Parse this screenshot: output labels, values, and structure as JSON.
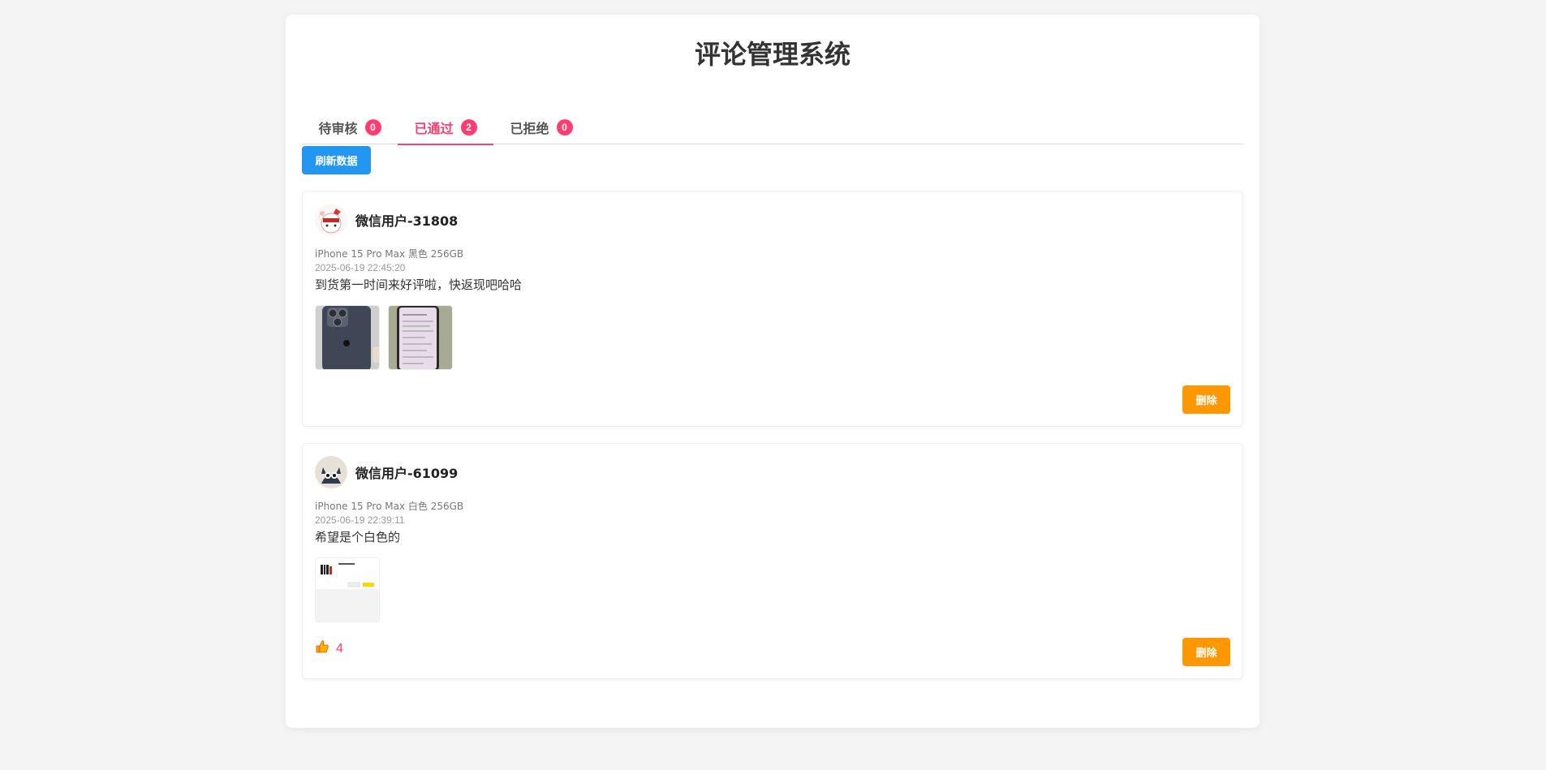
{
  "page": {
    "title": "评论管理系统"
  },
  "tabs": [
    {
      "label": "待审核",
      "count": "0"
    },
    {
      "label": "已通过",
      "count": "2"
    },
    {
      "label": "已拒绝",
      "count": "0"
    }
  ],
  "toolbar": {
    "refresh_label": "刷新数据"
  },
  "comments": [
    {
      "user": "微信用户-31808",
      "product": "iPhone 15 Pro Max 黑色 256GB",
      "time": "2025-06-19 22:45:20",
      "content": "到货第一时间来好评啦，快返现吧哈哈",
      "delete_label": "删除"
    },
    {
      "user": "微信用户-61099",
      "product": "iPhone 15 Pro Max 白色 256GB",
      "time": "2025-06-19 22:39:11",
      "content": "希望是个白色的",
      "likes": "4",
      "delete_label": "删除"
    }
  ],
  "colors": {
    "accent": "#ff3d6e",
    "refresh": "#2196f3",
    "delete": "#ff9800"
  }
}
